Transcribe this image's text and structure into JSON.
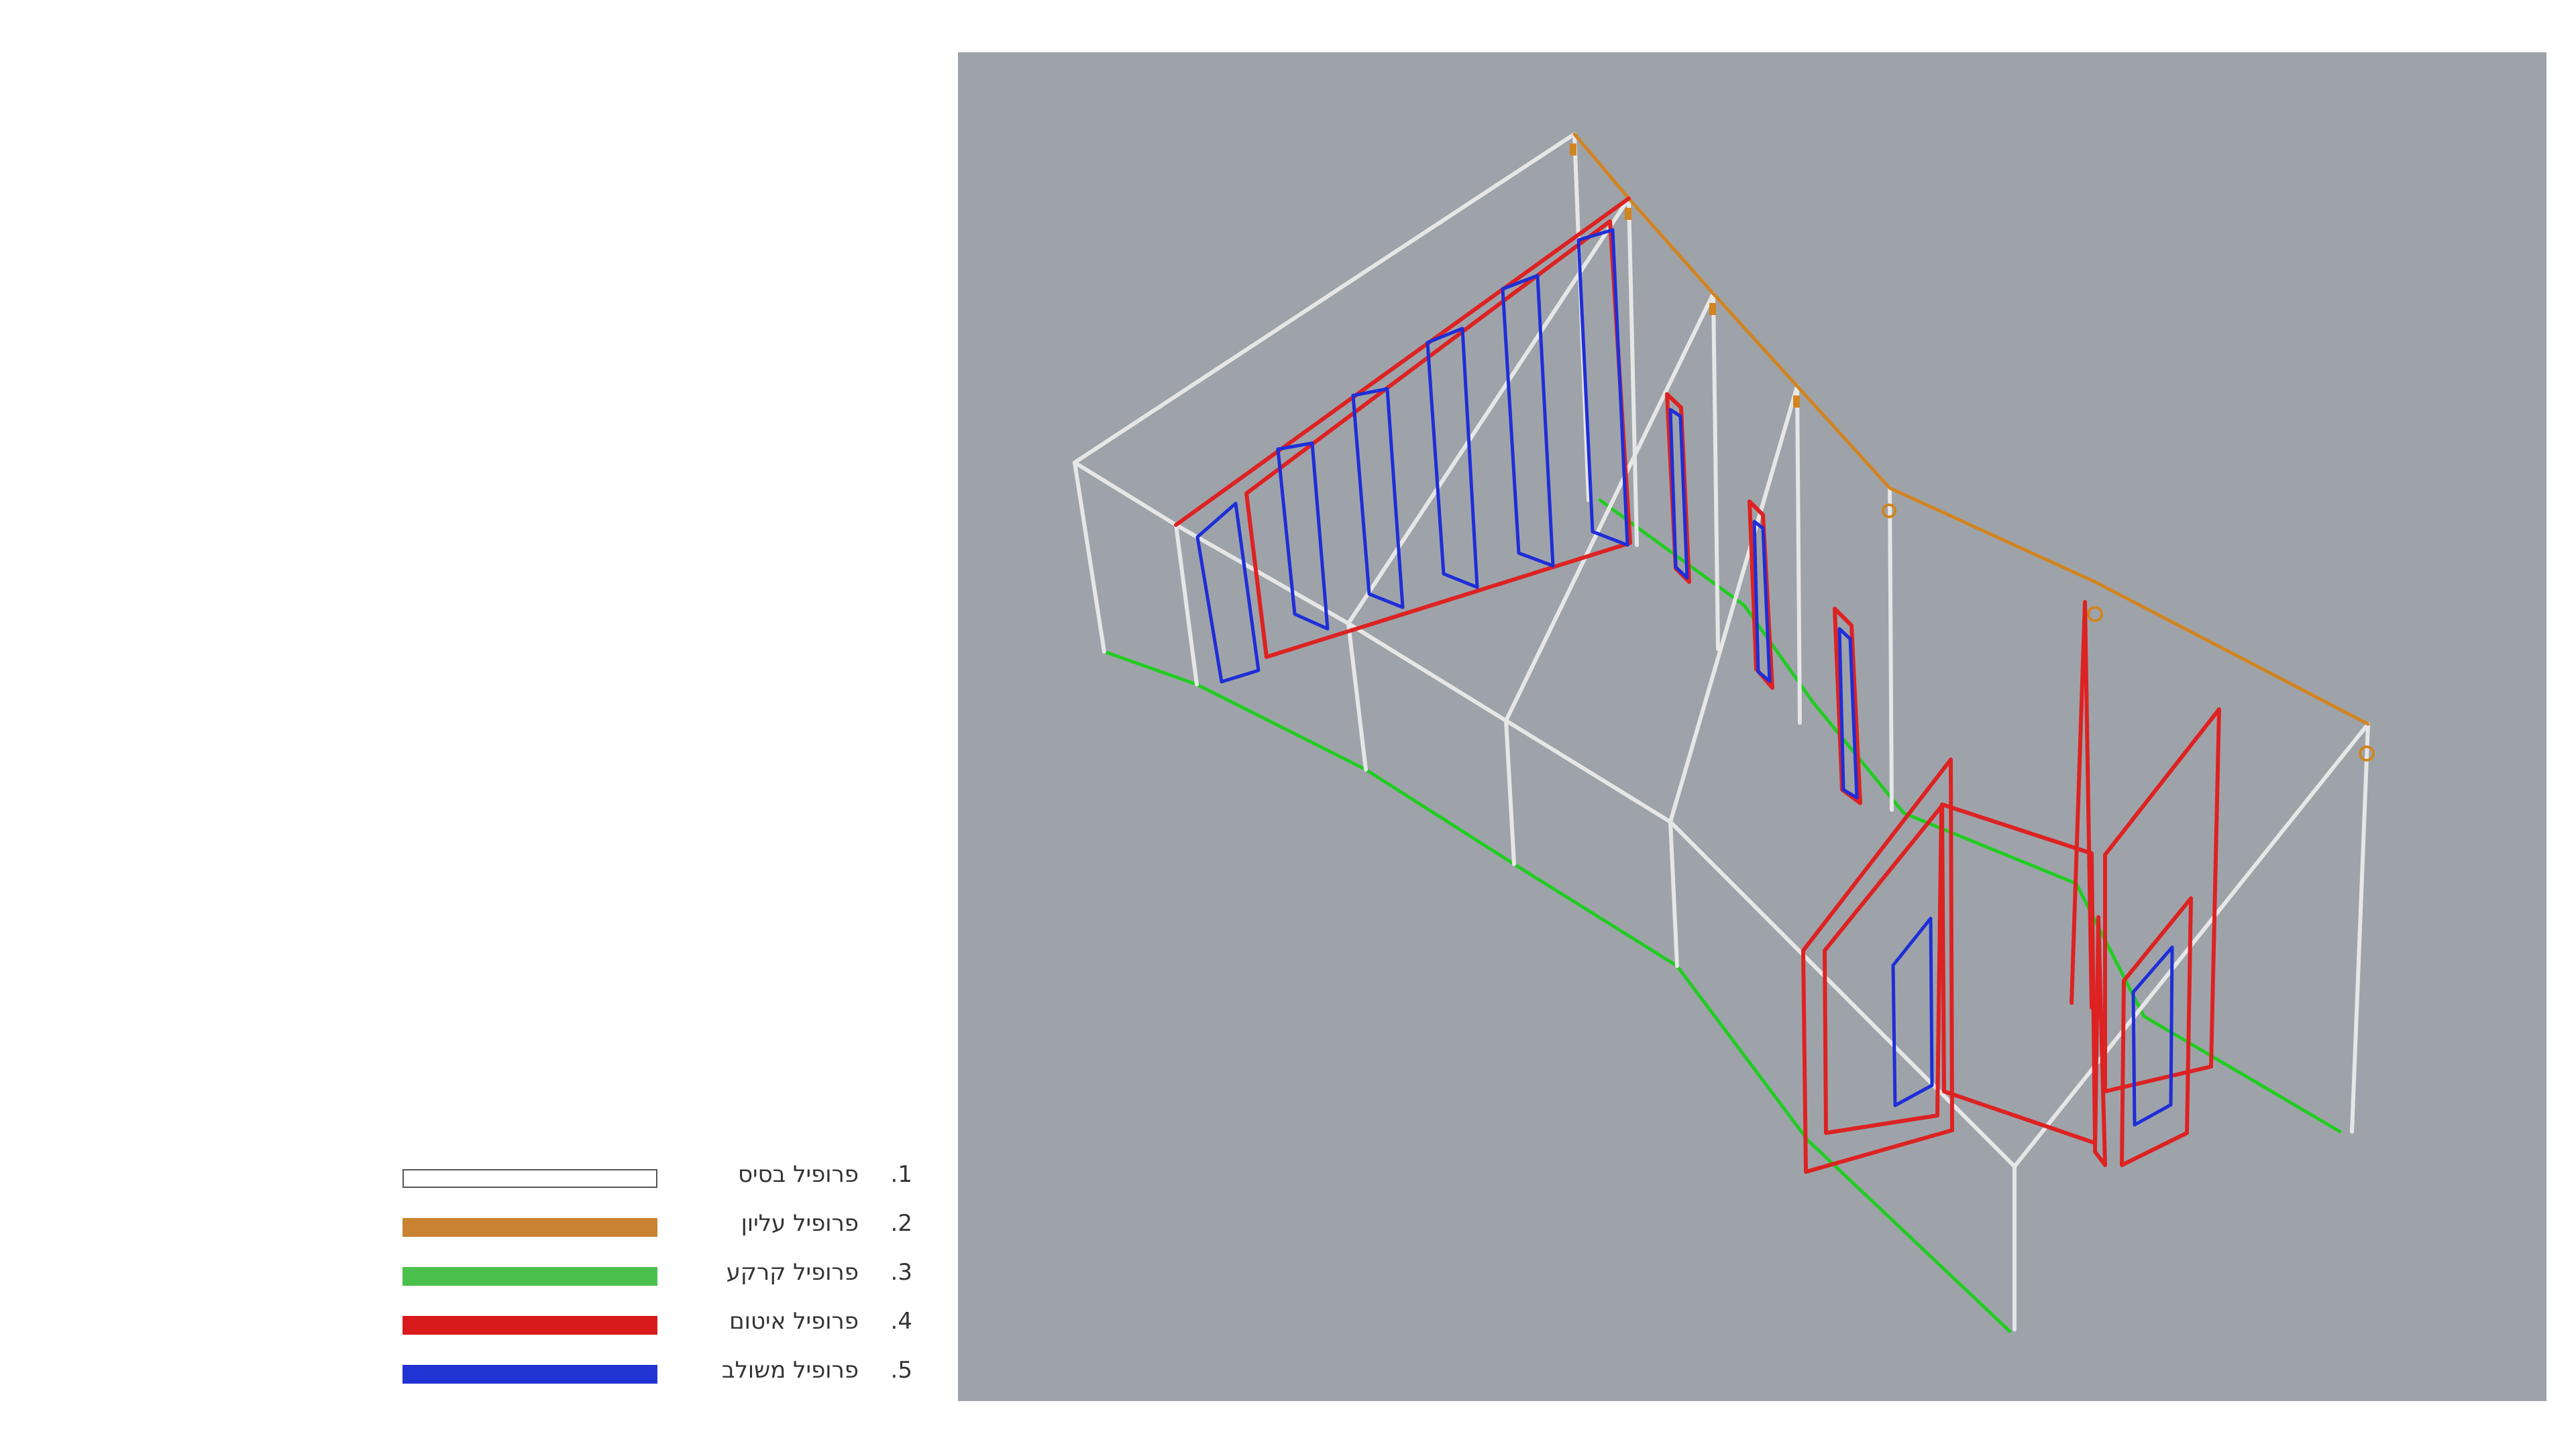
{
  "legend": {
    "items": [
      {
        "num": ".1",
        "label": "פרופיל בסיס",
        "color": "#ffffff",
        "border": "#555555"
      },
      {
        "num": ".2",
        "label": "פרופיל עליון",
        "color": "#C98232"
      },
      {
        "num": ".3",
        "label": "פרופיל קרקע",
        "color": "#4CC04C"
      },
      {
        "num": ".4",
        "label": "פרופיל איטום",
        "color": "#D91A1A"
      },
      {
        "num": ".5",
        "label": "פרופיל משולב",
        "color": "#2233D4"
      }
    ]
  },
  "viewport": {
    "background": "#9EA3AA",
    "base_color": "#E6E6E6",
    "top_color": "#D28420",
    "ground_color": "#22CC22",
    "seal_color": "#DD2222",
    "combo_color": "#1E2ED8"
  }
}
